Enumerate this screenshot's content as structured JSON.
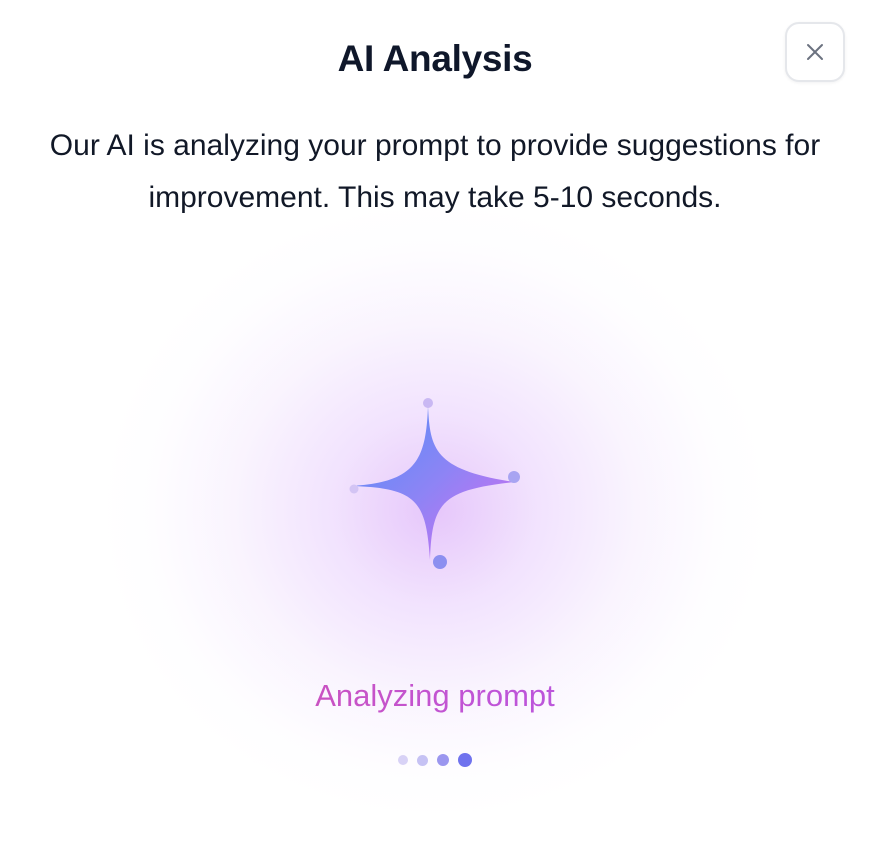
{
  "dialog": {
    "title": "AI Analysis",
    "description": "Our AI is analyzing your prompt to provide suggestions for improvement. This may take 5-10 seconds.",
    "status": "Analyzing prompt",
    "close_icon": "close-icon",
    "sparkle_icon": "sparkle-icon"
  },
  "progress_dots": {
    "count": 4,
    "active_index": 3
  },
  "colors": {
    "title": "#0f172a",
    "status_gradient_start": "#db4f9b",
    "status_gradient_end": "#a95df0",
    "sparkle_start": "#4f8ff7",
    "sparkle_end": "#d96bf0",
    "dot_active": "#6f72ee"
  }
}
